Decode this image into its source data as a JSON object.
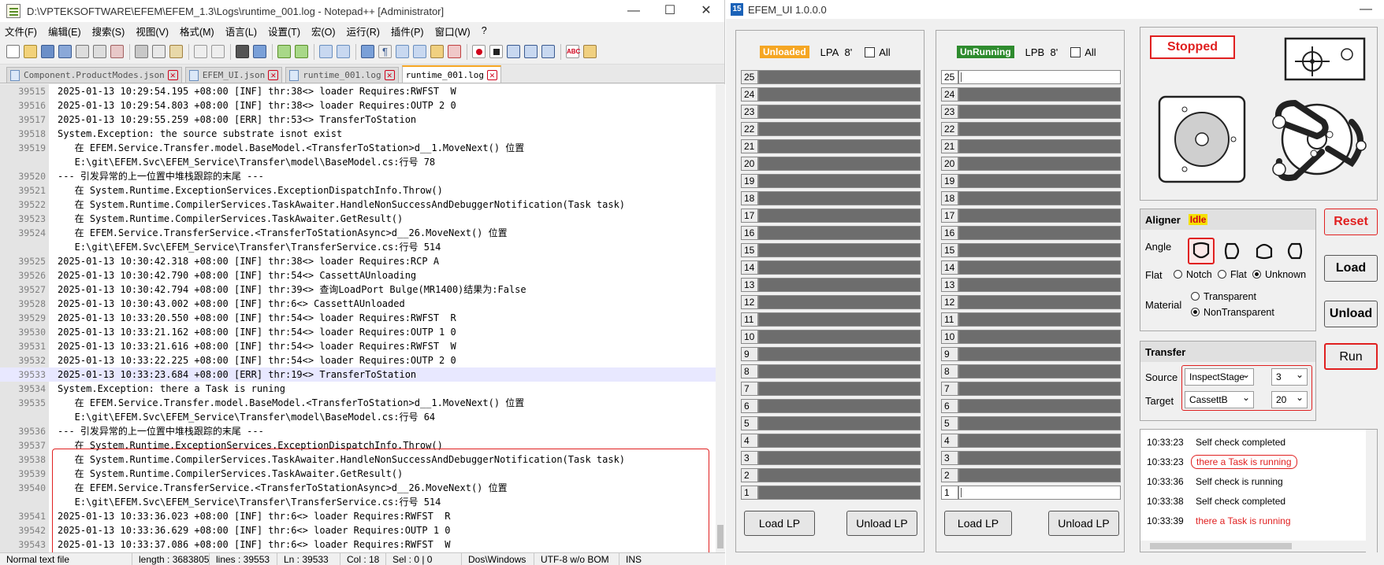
{
  "npp": {
    "title": "D:\\VPTEKSOFTWARE\\EFEM\\EFEM_1.3\\Logs\\runtime_001.log - Notepad++ [Administrator]",
    "menu": [
      "文件(F)",
      "编辑(E)",
      "搜索(S)",
      "视图(V)",
      "格式(M)",
      "语言(L)",
      "设置(T)",
      "宏(O)",
      "运行(R)",
      "插件(P)",
      "窗口(W)",
      "?"
    ],
    "tabs": [
      "Component.ProductModes.json",
      "EFEM_UI.json",
      "runtime_001.log",
      "runtime_001.log"
    ],
    "lines": [
      {
        "n": "39515",
        "t": "2025-01-13 10:29:54.195 +08:00 [INF] thr:38<> loader Requires:RWFST  W"
      },
      {
        "n": "39516",
        "t": "2025-01-13 10:29:54.803 +08:00 [INF] thr:38<> loader Requires:OUTP 2 0"
      },
      {
        "n": "39517",
        "t": "2025-01-13 10:29:55.259 +08:00 [ERR] thr:53<> TransferToStation"
      },
      {
        "n": "39518",
        "t": "System.Exception: the source substrate isnot exist"
      },
      {
        "n": "39519",
        "t": "   在 EFEM.Service.Transfer.model.BaseModel.<TransferToStation>d__1.MoveNext() 位置"
      },
      {
        "n": "",
        "t": "   E:\\git\\EFEM.Svc\\EFEM_Service\\Transfer\\model\\BaseModel.cs:行号 78"
      },
      {
        "n": "39520",
        "t": "--- 引发异常的上一位置中堆栈跟踪的末尾 ---"
      },
      {
        "n": "39521",
        "t": "   在 System.Runtime.ExceptionServices.ExceptionDispatchInfo.Throw()"
      },
      {
        "n": "39522",
        "t": "   在 System.Runtime.CompilerServices.TaskAwaiter.HandleNonSuccessAndDebuggerNotification(Task task)"
      },
      {
        "n": "39523",
        "t": "   在 System.Runtime.CompilerServices.TaskAwaiter.GetResult()"
      },
      {
        "n": "39524",
        "t": "   在 EFEM.Service.TransferService.<TransferToStationAsync>d__26.MoveNext() 位置"
      },
      {
        "n": "",
        "t": "   E:\\git\\EFEM.Svc\\EFEM_Service\\Transfer\\TransferService.cs:行号 514"
      },
      {
        "n": "39525",
        "t": "2025-01-13 10:30:42.318 +08:00 [INF] thr:38<> loader Requires:RCP A"
      },
      {
        "n": "39526",
        "t": "2025-01-13 10:30:42.790 +08:00 [INF] thr:54<> CassettAUnloading"
      },
      {
        "n": "39527",
        "t": "2025-01-13 10:30:42.794 +08:00 [INF] thr:39<> 查询LoadPort Bulge(MR1400)结果为:False"
      },
      {
        "n": "39528",
        "t": "2025-01-13 10:30:43.002 +08:00 [INF] thr:6<> CassettAUnloaded"
      },
      {
        "n": "39529",
        "t": "2025-01-13 10:33:20.550 +08:00 [INF] thr:54<> loader Requires:RWFST  R"
      },
      {
        "n": "39530",
        "t": "2025-01-13 10:33:21.162 +08:00 [INF] thr:54<> loader Requires:OUTP 1 0"
      },
      {
        "n": "39531",
        "t": "2025-01-13 10:33:21.616 +08:00 [INF] thr:54<> loader Requires:RWFST  W"
      },
      {
        "n": "39532",
        "t": "2025-01-13 10:33:22.225 +08:00 [INF] thr:54<> loader Requires:OUTP 2 0"
      },
      {
        "n": "39533",
        "t": "2025-01-13 10:33:23.684 +08:00 [ERR] thr:19<> TransferToStation",
        "cur": true
      },
      {
        "n": "39534",
        "t": "System.Exception: there a Task is runing"
      },
      {
        "n": "39535",
        "t": "   在 EFEM.Service.Transfer.model.BaseModel.<TransferToStation>d__1.MoveNext() 位置"
      },
      {
        "n": "",
        "t": "   E:\\git\\EFEM.Svc\\EFEM_Service\\Transfer\\model\\BaseModel.cs:行号 64"
      },
      {
        "n": "39536",
        "t": "--- 引发异常的上一位置中堆栈跟踪的末尾 ---"
      },
      {
        "n": "39537",
        "t": "   在 System.Runtime.ExceptionServices.ExceptionDispatchInfo.Throw()"
      },
      {
        "n": "39538",
        "t": "   在 System.Runtime.CompilerServices.TaskAwaiter.HandleNonSuccessAndDebuggerNotification(Task task)"
      },
      {
        "n": "39539",
        "t": "   在 System.Runtime.CompilerServices.TaskAwaiter.GetResult()"
      },
      {
        "n": "39540",
        "t": "   在 EFEM.Service.TransferService.<TransferToStationAsync>d__26.MoveNext() 位置"
      },
      {
        "n": "",
        "t": "   E:\\git\\EFEM.Svc\\EFEM_Service\\Transfer\\TransferService.cs:行号 514"
      },
      {
        "n": "39541",
        "t": "2025-01-13 10:33:36.023 +08:00 [INF] thr:6<> loader Requires:RWFST  R"
      },
      {
        "n": "39542",
        "t": "2025-01-13 10:33:36.629 +08:00 [INF] thr:6<> loader Requires:OUTP 1 0"
      },
      {
        "n": "39543",
        "t": "2025-01-13 10:33:37.086 +08:00 [INF] thr:6<> loader Requires:RWFST  W"
      }
    ],
    "status": {
      "type": "Normal text file",
      "length": "length : 3683805",
      "lines": "lines : 39553",
      "pos": "Ln : 39533",
      "col": "Col : 18",
      "sel": "Sel : 0 | 0",
      "eol": "Dos\\Windows",
      "enc": "UTF-8 w/o BOM",
      "ins": "INS"
    }
  },
  "efem": {
    "title": "EFEM_UI 1.0.0.0",
    "logo": "15",
    "lpa": {
      "badge": "Unloaded",
      "badge_bg": "#f5a623",
      "label": "LPA",
      "size": "8'",
      "all": "All",
      "load": "Load LP",
      "unload": "Unload LP"
    },
    "lpb": {
      "badge": "UnRunning",
      "badge_bg": "#2e8b2e",
      "label": "LPB",
      "size": "8'",
      "all": "All",
      "load": "Load LP",
      "unload": "Unload LP"
    },
    "slots": [
      "25",
      "24",
      "23",
      "22",
      "21",
      "20",
      "19",
      "18",
      "17",
      "16",
      "15",
      "14",
      "13",
      "12",
      "11",
      "10",
      "9",
      "8",
      "7",
      "6",
      "5",
      "4",
      "3",
      "2",
      "1"
    ],
    "state": "Stopped",
    "aligner": {
      "title": "Aligner",
      "status": "Idle",
      "angle_label": "Angle",
      "flat_label": "Flat",
      "flat_options": [
        "Notch",
        "Flat",
        "Unknown"
      ],
      "material_label": "Material",
      "material_options": [
        "Transparent",
        "NonTransparent"
      ]
    },
    "transfer": {
      "title": "Transfer",
      "source_label": "Source",
      "source_value": "InspectStage",
      "source_slot": "3",
      "target_label": "Target",
      "target_value": "CassettB",
      "target_slot": "20"
    },
    "buttons": {
      "reset": "Reset",
      "load": "Load",
      "unload": "Unload",
      "run": "Run"
    },
    "log": [
      {
        "time": "10:33:23",
        "msg": "Self check completed",
        "err": false
      },
      {
        "time": "10:33:23",
        "msg": "there a Task is running",
        "err": true
      },
      {
        "time": "10:33:36",
        "msg": "Self check is running",
        "err": false
      },
      {
        "time": "10:33:38",
        "msg": "Self check completed",
        "err": false
      },
      {
        "time": "10:33:39",
        "msg": "there a Task is running",
        "err": true
      }
    ],
    "colors": {
      "accent_red": "#e02020"
    }
  }
}
